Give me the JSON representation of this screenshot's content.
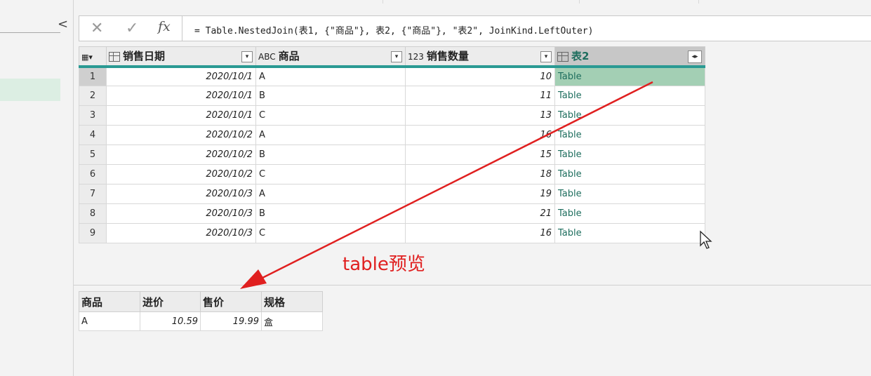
{
  "left_panel": {
    "collapse_glyph": "<"
  },
  "formula_bar": {
    "cancel_glyph": "✕",
    "confirm_glyph": "✓",
    "fx_label": "fx",
    "formula": "= Table.NestedJoin(表1, {\"商品\"}, 表2, {\"商品\"}, \"表2\", JoinKind.LeftOuter)"
  },
  "grid": {
    "columns": [
      {
        "type_icon": "calendar-icon",
        "label": "销售日期"
      },
      {
        "type_icon": "ABC",
        "label": "商品"
      },
      {
        "type_icon": "123",
        "label": "销售数量"
      },
      {
        "type_icon": "table-icon",
        "label": "表2"
      }
    ],
    "rows": [
      {
        "idx": "1",
        "date": "2020/10/1",
        "product": "A",
        "qty": "10",
        "t2": "Table"
      },
      {
        "idx": "2",
        "date": "2020/10/1",
        "product": "B",
        "qty": "11",
        "t2": "Table"
      },
      {
        "idx": "3",
        "date": "2020/10/1",
        "product": "C",
        "qty": "13",
        "t2": "Table"
      },
      {
        "idx": "4",
        "date": "2020/10/2",
        "product": "A",
        "qty": "16",
        "t2": "Table"
      },
      {
        "idx": "5",
        "date": "2020/10/2",
        "product": "B",
        "qty": "15",
        "t2": "Table"
      },
      {
        "idx": "6",
        "date": "2020/10/2",
        "product": "C",
        "qty": "18",
        "t2": "Table"
      },
      {
        "idx": "7",
        "date": "2020/10/3",
        "product": "A",
        "qty": "19",
        "t2": "Table"
      },
      {
        "idx": "8",
        "date": "2020/10/3",
        "product": "B",
        "qty": "21",
        "t2": "Table"
      },
      {
        "idx": "9",
        "date": "2020/10/3",
        "product": "C",
        "qty": "16",
        "t2": "Table"
      }
    ]
  },
  "preview": {
    "headers": [
      "商品",
      "进价",
      "售价",
      "规格"
    ],
    "row": [
      "A",
      "10.59",
      "19.99",
      "盒"
    ]
  },
  "annotation": {
    "text": "table预览",
    "color": "#e02020"
  },
  "colors": {
    "accent_bar": "#2a9a93",
    "selected_cell": "#a3cfb4",
    "table_link": "#1e6e5e"
  }
}
